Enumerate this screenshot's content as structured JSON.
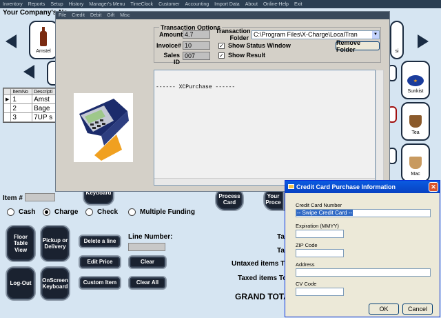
{
  "top_menu": [
    "Inventory",
    "Reports",
    "Setup",
    "History",
    "Manager's Menu",
    "TimeClock",
    "Customer",
    "Accounting",
    "Import Data",
    "About",
    "Online-Help",
    "Exit"
  ],
  "company": "Your Company's Na",
  "products": {
    "amstel": "Amstel",
    "sunkist": "Sunkist",
    "tea": "Tea",
    "mac": "Mac",
    "partial_si": "si"
  },
  "order_grid": {
    "columns": [
      "ItemNo",
      "Descripti"
    ],
    "rows": [
      {
        "no": "1",
        "desc": "Amst",
        "current": true
      },
      {
        "no": "2",
        "desc": "Bage",
        "current": false
      },
      {
        "no": "3",
        "desc": "7UP s",
        "current": false
      }
    ]
  },
  "item_label": "Item #",
  "payment": {
    "cash": "Cash",
    "charge": "Charge",
    "check": "Check",
    "multiple": "Multiple Funding"
  },
  "buttons": {
    "floor_table": "Floor Table View",
    "pickup": "Pickup or Delivery",
    "logout": "Log-Out",
    "onscreen_kb": "OnScreen Keyboard",
    "onscreen_kb2": "OnScreen Keyboard",
    "delete_line": "Delete a line",
    "edit_price": "Edit Price",
    "custom_item": "Custom Item",
    "clear": "Clear",
    "clear_all": "Clear All",
    "process_card": "Process Card",
    "your_proc": "Your Proce"
  },
  "line_number_label": "Line Number:",
  "totals": {
    "tax1": "Tax",
    "tax2": "Tax",
    "untaxed": "Untaxed items Tota",
    "taxed": "Taxed items Tota",
    "grand": "GRAND TOTAL"
  },
  "transaction": {
    "menu": [
      "File",
      "Credit",
      "Debit",
      "Gift",
      "Misc"
    ],
    "options_title": "Transaction Options",
    "amount_label": "Amount",
    "amount": "4.7",
    "invoice_label": "Invoice#",
    "invoice": "10",
    "sales_id_label": "Sales ID",
    "sales_id": "007",
    "folder_label": "Transaction Folder",
    "folder": "C:\\Program Files\\X-Charge\\LocalTran",
    "show_status": "Show Status Window",
    "show_result": "Show Result",
    "remove_folder": "Remove Folder",
    "log_text": "------  XCPurchase  ------"
  },
  "cc_dialog": {
    "title": "Credit Card Purchase Information",
    "card_number_label": "Credit Card Number",
    "card_number_value": "-- Swipe Credit Card --",
    "expiration_label": "Expiration (MMYY)",
    "zip_label": "ZIP Code",
    "address_label": "Address",
    "cv_label": "CV Code",
    "ok": "OK",
    "cancel": "Cancel"
  },
  "colors": {
    "background": "#d6e5f2",
    "dark_button": "#1a2230",
    "xp_blue": "#0842c2"
  }
}
